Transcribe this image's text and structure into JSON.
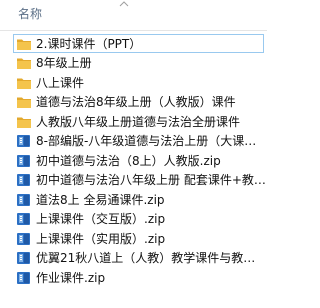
{
  "header": {
    "name_column": "名称"
  },
  "colors": {
    "folder": "#f4c44c",
    "folder_dark": "#e3a92e",
    "zip_blue": "#2b6fc4",
    "header_text": "#5a6e86",
    "selection_border": "#99c9ef"
  },
  "files": [
    {
      "name": "2.课时课件（PPT）",
      "type": "folder",
      "icon": "folder-icon",
      "selected": true
    },
    {
      "name": "8年级上册",
      "type": "folder",
      "icon": "folder-icon"
    },
    {
      "name": "八上课件",
      "type": "folder",
      "icon": "folder-icon"
    },
    {
      "name": "道德与法治8年级上册（人教版）课件",
      "type": "folder",
      "icon": "folder-icon"
    },
    {
      "name": "人教版八年级上册道德与法治全册课件",
      "type": "folder",
      "icon": "folder-icon"
    },
    {
      "name": "8-部编版-八年级道德与法治上册（大课…",
      "type": "zip",
      "icon": "zip-archive-icon"
    },
    {
      "name": "初中道德与法治（8上）人教版.zip",
      "type": "zip",
      "icon": "zip-archive-icon"
    },
    {
      "name": "初中道德与法治八年级上册 配套课件+教…",
      "type": "zip",
      "icon": "zip-archive-icon"
    },
    {
      "name": "道法8上 全易通课件.zip",
      "type": "zip",
      "icon": "zip-archive-icon"
    },
    {
      "name": "上课课件（交互版）.zip",
      "type": "zip",
      "icon": "zip-archive-icon"
    },
    {
      "name": "上课课件（实用版）.zip",
      "type": "zip",
      "icon": "zip-archive-icon"
    },
    {
      "name": "优翼21秋八道上（人教）教学课件与教…",
      "type": "zip",
      "icon": "zip-archive-icon"
    },
    {
      "name": "作业课件.zip",
      "type": "zip",
      "icon": "zip-archive-icon"
    }
  ]
}
